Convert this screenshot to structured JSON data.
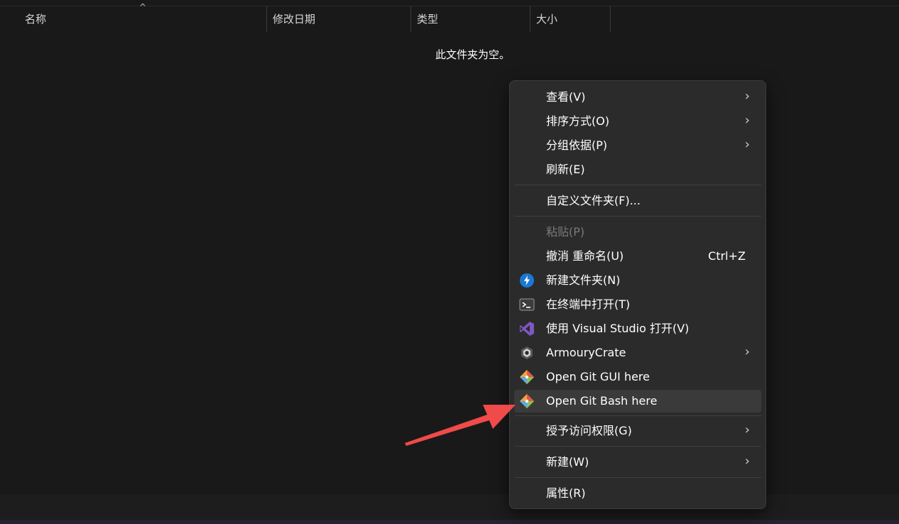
{
  "columns": {
    "name": "名称",
    "modified": "修改日期",
    "type": "类型",
    "size": "大小",
    "sort_indicator": "^"
  },
  "empty_message": "此文件夹为空。",
  "context_menu": {
    "view": {
      "label": "查看(V)",
      "chevron": "›"
    },
    "sort_by": {
      "label": "排序方式(O)",
      "chevron": "›"
    },
    "group_by": {
      "label": "分组依据(P)",
      "chevron": "›"
    },
    "refresh": {
      "label": "刷新(E)"
    },
    "customize": {
      "label": "自定义文件夹(F)..."
    },
    "paste": {
      "label": "粘贴(P)"
    },
    "undo_rename": {
      "label": "撤消 重命名(U)",
      "shortcut": "Ctrl+Z"
    },
    "new_folder": {
      "label": "新建文件夹(N)",
      "icon": "new-folder-icon"
    },
    "open_terminal": {
      "label": "在终端中打开(T)",
      "icon": "terminal-icon"
    },
    "open_vs": {
      "label": "使用 Visual Studio 打开(V)",
      "icon": "visual-studio-icon"
    },
    "armoury": {
      "label": "ArmouryCrate",
      "chevron": "›",
      "icon": "armoury-crate-icon"
    },
    "git_gui": {
      "label": "Open Git GUI here",
      "icon": "git-icon"
    },
    "git_bash": {
      "label": "Open Git Bash here",
      "icon": "git-icon"
    },
    "grant_access": {
      "label": "授予访问权限(G)",
      "chevron": "›"
    },
    "new": {
      "label": "新建(W)",
      "chevron": "›"
    },
    "properties": {
      "label": "属性(R)"
    }
  },
  "colors": {
    "background": "#191919",
    "menu_background": "#2b2b2b",
    "hover": "#3a3a3a",
    "arrow": "#f04a4a"
  }
}
